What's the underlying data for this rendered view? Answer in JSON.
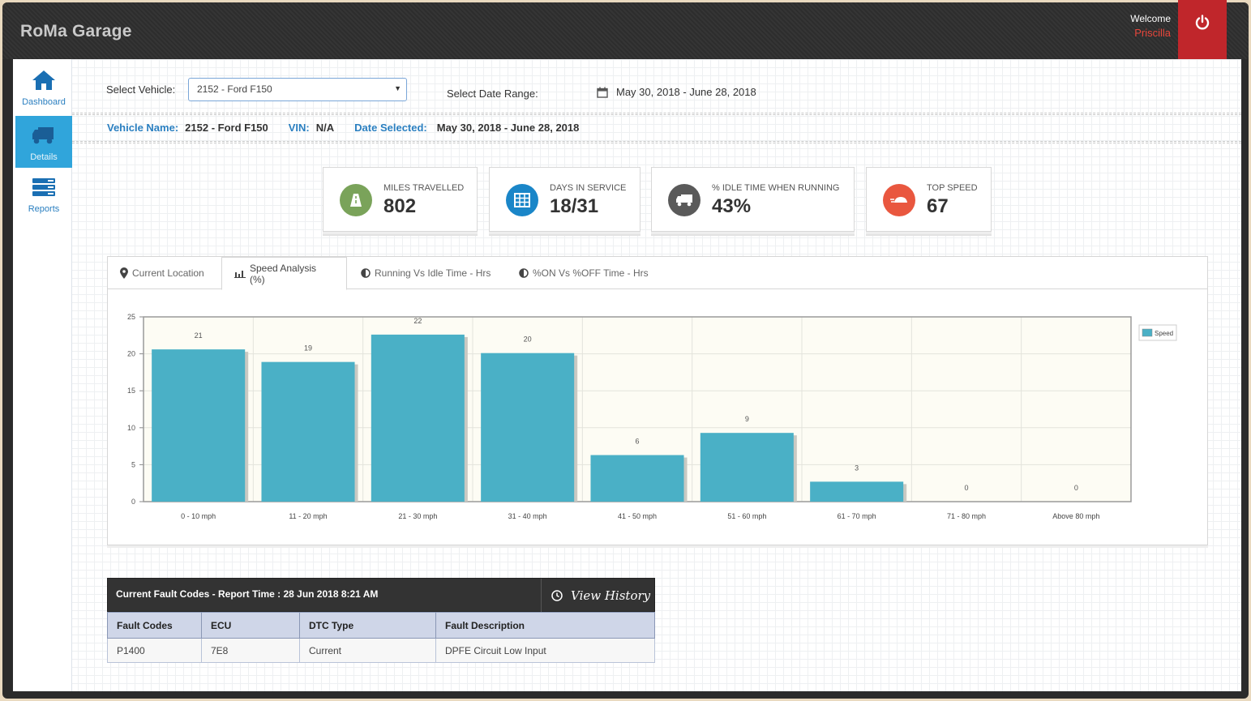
{
  "app": {
    "brand": "RoMa Garage",
    "welcome": "Welcome",
    "user": "Priscilla"
  },
  "sidebar": {
    "items": [
      {
        "label": "Dashboard",
        "icon": "home-icon"
      },
      {
        "label": "Details",
        "icon": "truck-icon",
        "active": true
      },
      {
        "label": "Reports",
        "icon": "list-icon"
      }
    ]
  },
  "filters": {
    "vehicle_label": "Select Vehicle:",
    "vehicle_value": "2152 - Ford F150",
    "date_label": "Select Date Range:",
    "date_value": "May 30, 2018 - June 28, 2018"
  },
  "info": {
    "vehicle_name_label": "Vehicle Name:",
    "vehicle_name": "2152 - Ford F150",
    "vin_label": "VIN:",
    "vin": "N/A",
    "date_selected_label": "Date Selected:",
    "date_selected": "May 30, 2018 - June 28, 2018"
  },
  "stats": [
    {
      "title": "MILES TRAVELLED",
      "value": "802",
      "icon": "road-icon",
      "color": "#7aa35a"
    },
    {
      "title": "DAYS IN SERVICE",
      "value": "18/31",
      "icon": "calendar-grid-icon",
      "color": "#1a86c8"
    },
    {
      "title": "% IDLE TIME WHEN RUNNING",
      "value": "43%",
      "icon": "truck-icon",
      "color": "#5a5a5a"
    },
    {
      "title": "TOP SPEED",
      "value": "67",
      "icon": "speed-car-icon",
      "color": "#e9573f"
    }
  ],
  "tabs": [
    {
      "label": "Current Location",
      "icon": "map-marker-icon"
    },
    {
      "label": "Speed Analysis (%)",
      "icon": "bar-chart-icon",
      "active": true
    },
    {
      "label": "Running Vs Idle Time - Hrs",
      "icon": "half-circle-icon"
    },
    {
      "label": "%ON Vs %OFF Time - Hrs",
      "icon": "half-circle-icon"
    }
  ],
  "chart_data": {
    "type": "bar",
    "categories": [
      "0 - 10 mph",
      "11 - 20 mph",
      "21 - 30 mph",
      "31 - 40 mph",
      "41 - 50 mph",
      "51 - 60 mph",
      "61 - 70 mph",
      "71 - 80 mph",
      "Above 80 mph"
    ],
    "series": [
      {
        "name": "Speed",
        "values": [
          21,
          19,
          22,
          20,
          6,
          9,
          3,
          0,
          0
        ],
        "plotted": [
          20.6,
          18.9,
          22.6,
          20.1,
          6.3,
          9.3,
          2.7,
          0,
          0
        ]
      }
    ],
    "ylim": [
      0,
      25
    ],
    "yticks": [
      "0",
      "5",
      "10",
      "15",
      "20",
      "25"
    ],
    "grid": true,
    "legend": "top-right",
    "bar_color": "#4ab0c6"
  },
  "fault": {
    "title": "Current Fault Codes - Report Time : 28 Jun 2018 8:21 AM",
    "history_label": "View History",
    "columns": [
      "Fault Codes",
      "ECU",
      "DTC Type",
      "Fault Description"
    ],
    "rows": [
      [
        "P1400",
        "7E8",
        "Current",
        "DPFE Circuit Low Input"
      ]
    ]
  }
}
